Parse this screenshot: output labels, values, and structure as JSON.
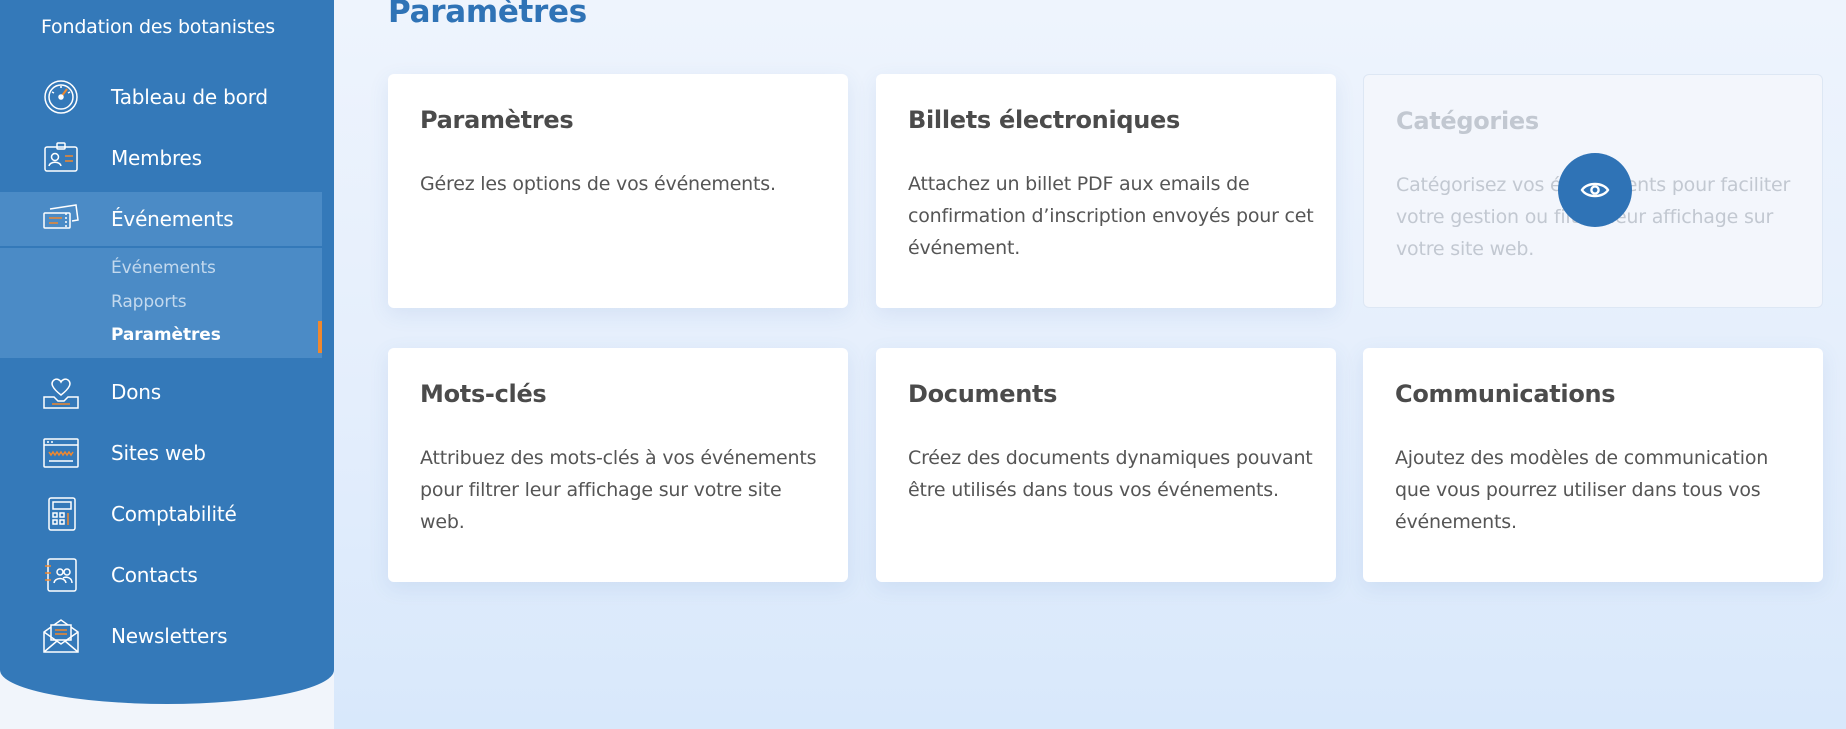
{
  "app": {
    "org_name": "Fondation des botanistes"
  },
  "sidebar": {
    "items": [
      {
        "label": "Tableau de bord",
        "icon": "dashboard-gauge-icon"
      },
      {
        "label": "Membres",
        "icon": "member-badge-icon"
      },
      {
        "label": "Événements",
        "icon": "event-tickets-icon",
        "active": true
      },
      {
        "label": "Dons",
        "icon": "donation-heart-icon"
      },
      {
        "label": "Sites web",
        "icon": "website-browser-icon"
      },
      {
        "label": "Comptabilité",
        "icon": "calculator-icon"
      },
      {
        "label": "Contacts",
        "icon": "contacts-book-icon"
      },
      {
        "label": "Newsletters",
        "icon": "newsletter-envelope-icon"
      }
    ],
    "subitems": [
      {
        "label": "Événements"
      },
      {
        "label": "Rapports"
      },
      {
        "label": "Paramètres",
        "current": true
      }
    ]
  },
  "main": {
    "title": "Paramètres",
    "cards": [
      {
        "title": "Paramètres",
        "description": "Gérez les options de vos événements."
      },
      {
        "title": "Billets électroniques",
        "description": "Attachez un billet PDF aux emails de confirmation d’inscription envoyés pour cet événement."
      },
      {
        "title": "Catégories",
        "description": "Catégorisez vos événements pour faciliter votre gestion ou filtrer leur affichage sur votre site web.",
        "disabled": true
      },
      {
        "title": "Mots-clés",
        "description": "Attribuez des mots-clés à vos événements pour filtrer leur affichage sur votre site web."
      },
      {
        "title": "Documents",
        "description": "Créez des documents dynamiques pouvant être utilisés dans tous vos événements."
      },
      {
        "title": "Communications",
        "description": "Ajoutez des modèles de communication que vous pourrez utiliser dans tous vos événements."
      }
    ]
  },
  "colors": {
    "sidebar": "#3479b9",
    "sidebar_active": "#4b8bc6",
    "accent": "#f0882e",
    "title": "#2f73b6"
  }
}
